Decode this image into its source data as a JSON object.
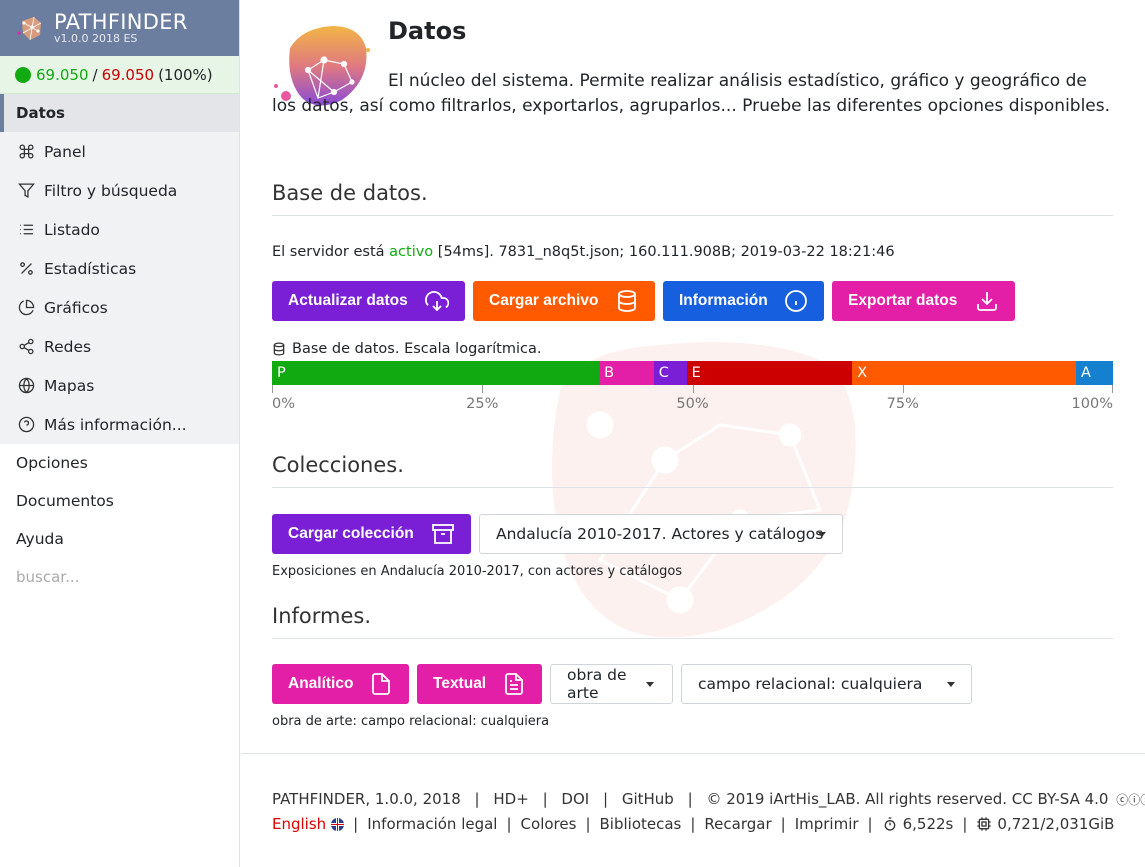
{
  "brand": {
    "title": "PATHFINDER",
    "version": "v1.0.0 2018 ES"
  },
  "status": {
    "current": "69.050",
    "slash": "/",
    "total": "69.050",
    "pct": "(100%)"
  },
  "nav": {
    "active": "Datos",
    "items": [
      {
        "label": "Panel",
        "icon": "command-icon"
      },
      {
        "label": "Filtro y búsqueda",
        "icon": "filter-icon"
      },
      {
        "label": "Listado",
        "icon": "list-icon"
      },
      {
        "label": "Estadísticas",
        "icon": "percent-icon"
      },
      {
        "label": "Gráficos",
        "icon": "pie-chart-icon"
      },
      {
        "label": "Redes",
        "icon": "share-icon"
      },
      {
        "label": "Mapas",
        "icon": "globe-icon"
      },
      {
        "label": "Más información...",
        "icon": "help-circle-icon"
      }
    ],
    "links": [
      "Opciones",
      "Documentos",
      "Ayuda"
    ],
    "search_placeholder": "buscar..."
  },
  "page": {
    "title": "Datos",
    "description": "El núcleo del sistema. Permite realizar análisis estadístico, gráfico y geográfico de los datos, así como filtrarlos, exportarlos, agruparlos... Pruebe las diferentes opciones disponibles."
  },
  "database": {
    "heading": "Base de datos.",
    "server_prefix": "El servidor está ",
    "server_state": "activo",
    "server_suffix": " [54ms]. 7831_n8q5t.json; 160.111.908B; 2019-03-22 18:21:46",
    "buttons": {
      "update": "Actualizar datos",
      "load_file": "Cargar archivo",
      "info": "Información",
      "export": "Exportar datos"
    },
    "bar_label": "Base de datos. Escala logarítmica.",
    "segments": [
      {
        "label": "P",
        "fraction": 0.389,
        "color": "#11aa11"
      },
      {
        "label": "B",
        "fraction": 0.065,
        "color": "#e21fa6"
      },
      {
        "label": "C",
        "fraction": 0.039,
        "color": "#7a1fd6"
      },
      {
        "label": "E",
        "fraction": 0.197,
        "color": "#cc0000"
      },
      {
        "label": "X",
        "fraction": 0.266,
        "color": "#ff5a00"
      },
      {
        "label": "A",
        "fraction": 0.044,
        "color": "#1580d0"
      }
    ],
    "axis_ticks": [
      "0%",
      "25%",
      "50%",
      "75%",
      "100%"
    ]
  },
  "collections": {
    "heading": "Colecciones.",
    "load_button": "Cargar colección",
    "selected": "Andalucía 2010-2017. Actores y catálogos",
    "note": "Exposiciones en Andalucía 2010-2017, con actores y catálogos"
  },
  "reports": {
    "heading": "Informes.",
    "analytic": "Analítico",
    "textual": "Textual",
    "entity_select": "obra de arte",
    "field_select": "campo relacional: cualquiera",
    "note": "obra de arte: campo relacional: cualquiera"
  },
  "footer": {
    "app": "PATHFINDER, 1.0.0, 2018",
    "hd": "HD+",
    "doi": "DOI",
    "github": "GitHub",
    "copyright": "© 2019 iArtHis_LAB. All rights reserved. CC BY-SA 4.0",
    "english": "English",
    "legal": "Información legal",
    "colors": "Colores",
    "libraries": "Bibliotecas",
    "reload": "Recargar",
    "print": "Imprimir",
    "time": "6,522s",
    "memory": "0,721/2,031GiB"
  },
  "colors": {
    "sidebar_header": "#6c7ea0",
    "purple": "#7a1fd6",
    "orange": "#ff5a00",
    "blue": "#1660e0",
    "pink": "#e21fa6",
    "green": "#11aa11",
    "red": "#cc0000"
  }
}
